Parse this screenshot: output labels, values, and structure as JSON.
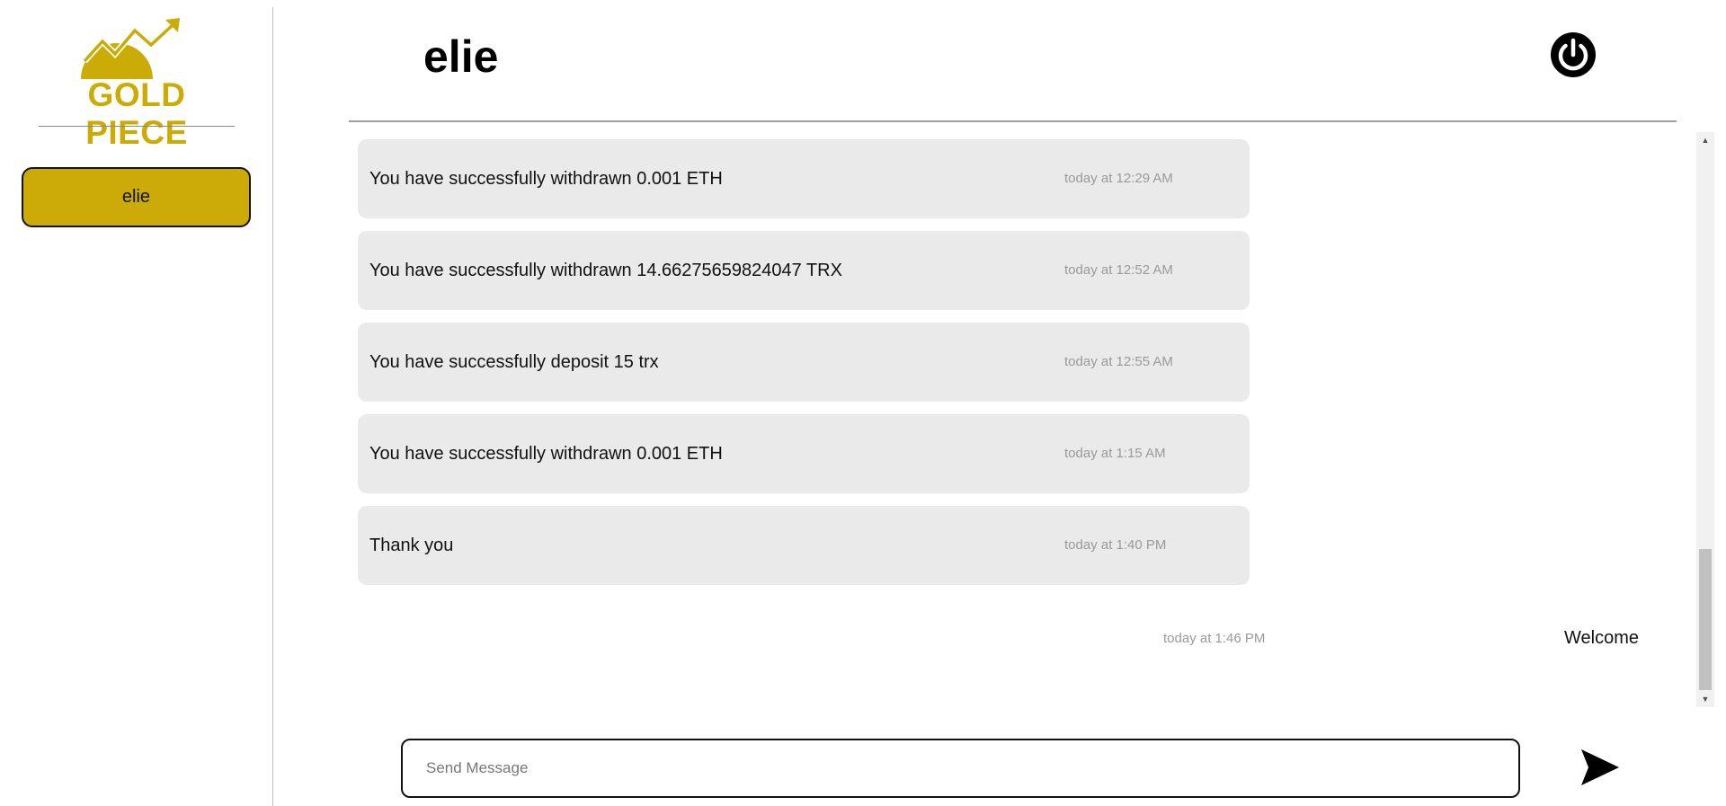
{
  "brand": {
    "logo_text": "GOLD PIECE",
    "color": "#cbac07"
  },
  "sidebar": {
    "users": [
      {
        "label": "elie"
      }
    ]
  },
  "header": {
    "title": "elie",
    "power_icon": "power-icon"
  },
  "messages": [
    {
      "text": "You have successfully withdrawn 0.001 ETH",
      "time": "today at 12:29 AM"
    },
    {
      "text": "You have successfully withdrawn 14.66275659824047 TRX",
      "time": "today at 12:52 AM"
    },
    {
      "text": "You have successfully deposit 15 trx",
      "time": "today at 12:55 AM"
    },
    {
      "text": "You have successfully withdrawn 0.001 ETH",
      "time": "today at 1:15 AM"
    },
    {
      "text": "Thank you",
      "time": "today at 1:40 PM"
    }
  ],
  "outgoing": {
    "text": "Welcome",
    "time": "today at 1:46 PM"
  },
  "composer": {
    "placeholder": "Send Message",
    "send_icon": "send-icon"
  },
  "colors": {
    "accent": "#ccab08",
    "bubble": "#eaeaea",
    "timestamp": "#9a9a9a"
  }
}
